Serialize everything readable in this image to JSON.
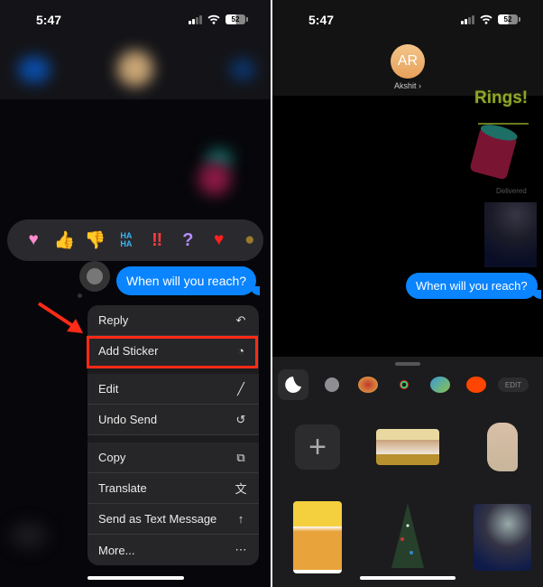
{
  "left": {
    "status": {
      "time": "5:47",
      "battery": "52"
    },
    "reactions": [
      "pink-heart",
      "thumbs-up",
      "thumbs-down",
      "haha",
      "exclamation",
      "question",
      "red-heart"
    ],
    "haha_text": [
      "HA",
      "HA"
    ],
    "message": "When will you reach?",
    "menu": [
      {
        "label": "Reply",
        "icon": "reply-icon",
        "glyph": "↶"
      },
      {
        "label": "Add Sticker",
        "icon": "add-sticker-icon",
        "glyph": "◔"
      },
      {
        "label": "Edit",
        "icon": "pencil-icon",
        "glyph": "╱"
      },
      {
        "label": "Undo Send",
        "icon": "undo-icon",
        "glyph": "↺"
      },
      {
        "label": "Copy",
        "icon": "copy-icon",
        "glyph": "⧉"
      },
      {
        "label": "Translate",
        "icon": "translate-icon",
        "glyph": "文"
      },
      {
        "label": "Send as Text Message",
        "icon": "send-up-icon",
        "glyph": "↑"
      },
      {
        "label": "More...",
        "icon": "more-icon",
        "glyph": "⋯"
      }
    ],
    "highlight_color": "#ff2a17"
  },
  "right": {
    "status": {
      "time": "5:47",
      "battery": "52"
    },
    "contact": {
      "initials": "AR",
      "name": "Akshit ›"
    },
    "sticker_text": "Rings!",
    "delivered": "Delivered",
    "message": "When will you reach?",
    "tray": {
      "tabs": [
        "stickers-tab",
        "memoji-tab",
        "game-app-tab",
        "activity-tab",
        "fruit-ninja-tab",
        "reddit-tab"
      ],
      "edit_label": "EDIT",
      "add_label": "+",
      "stickers": [
        "birthday-cake",
        "monkey",
        "mango-box",
        "christmas-tree",
        "ferris-wheel"
      ]
    }
  },
  "colors": {
    "imessage_blue": "#0a84ff",
    "menu_bg": "#262628",
    "tray_bg": "#1c1c1e"
  }
}
